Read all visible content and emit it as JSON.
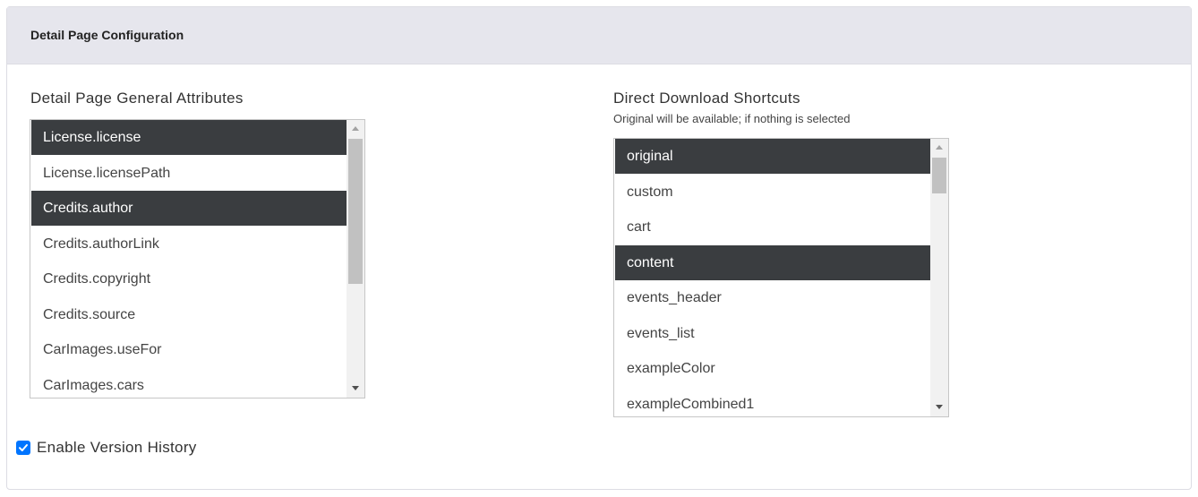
{
  "card": {
    "title": "Detail Page Configuration"
  },
  "general_attributes": {
    "label": "Detail Page General Attributes",
    "options": [
      {
        "label": "License.license",
        "selected": true
      },
      {
        "label": "License.licensePath",
        "selected": false
      },
      {
        "label": "Credits.author",
        "selected": true
      },
      {
        "label": "Credits.authorLink",
        "selected": false
      },
      {
        "label": "Credits.copyright",
        "selected": false
      },
      {
        "label": "Credits.source",
        "selected": false
      },
      {
        "label": "CarImages.useFor",
        "selected": false
      },
      {
        "label": "CarImages.cars",
        "selected": false
      }
    ]
  },
  "download_shortcuts": {
    "label": "Direct Download Shortcuts",
    "hint": "Original will be available; if nothing is selected",
    "options": [
      {
        "label": "original",
        "selected": true
      },
      {
        "label": "custom",
        "selected": false
      },
      {
        "label": "cart",
        "selected": false
      },
      {
        "label": "content",
        "selected": true
      },
      {
        "label": "events_header",
        "selected": false
      },
      {
        "label": "events_list",
        "selected": false
      },
      {
        "label": "exampleColor",
        "selected": false
      },
      {
        "label": "exampleCombined1",
        "selected": false
      }
    ]
  },
  "version_history": {
    "label": "Enable Version History",
    "checked": true
  },
  "colors": {
    "header_bg": "#e6e6ed",
    "selected_bg": "#3a3d40",
    "checkbox_accent": "#0075ff"
  }
}
